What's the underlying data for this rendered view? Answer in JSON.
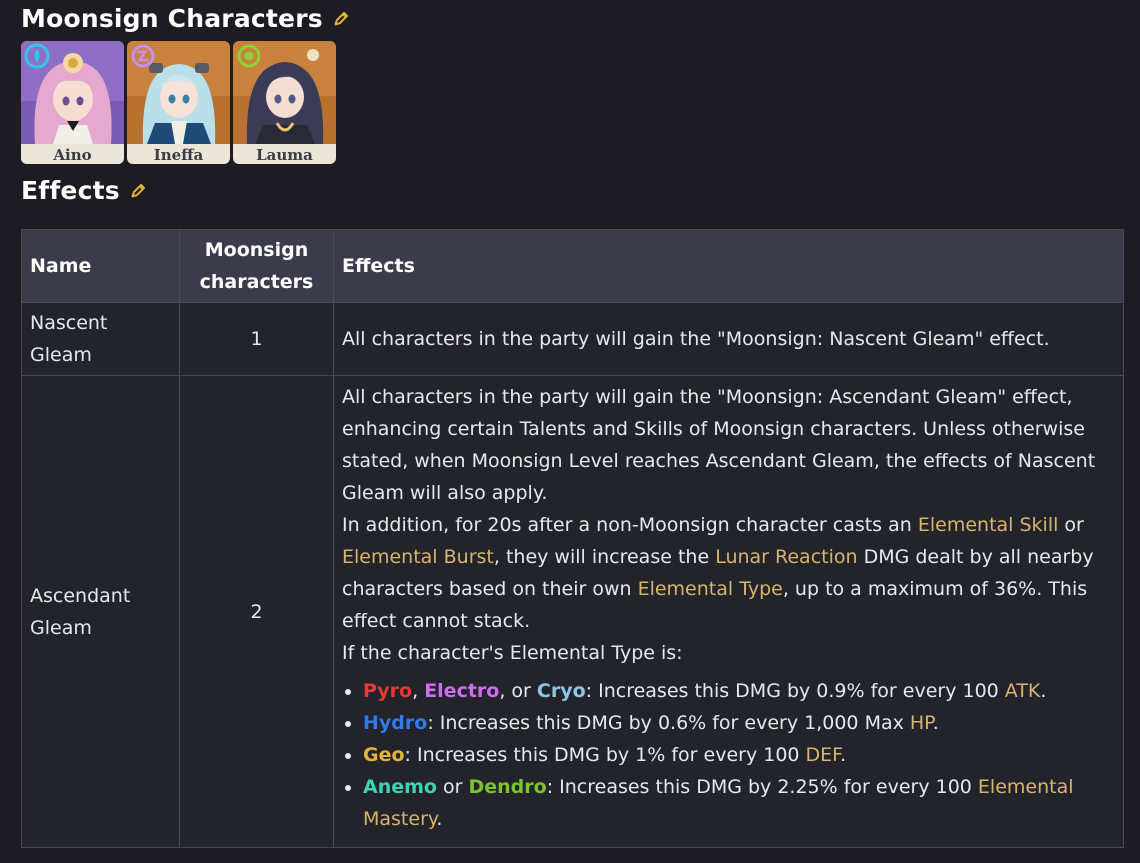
{
  "sections": {
    "characters_title": "Moonsign Characters",
    "effects_title": "Effects"
  },
  "characters": [
    {
      "name": "Aino",
      "element_icon": "hydro-icon"
    },
    {
      "name": "Ineffa",
      "element_icon": "electro-icon"
    },
    {
      "name": "Lauma",
      "element_icon": "dendro-icon"
    }
  ],
  "table": {
    "headers": {
      "name": "Name",
      "count": "Moonsign characters",
      "effects": "Effects"
    },
    "rows": [
      {
        "name": "Nascent Gleam",
        "count": "1",
        "effect": "All characters in the party will gain the \"Moonsign: Nascent Gleam\" effect."
      },
      {
        "name": "Ascendant Gleam",
        "count": "2",
        "effect_intro": "All characters in the party will gain the \"Moonsign: Ascendant Gleam\" effect, enhancing certain Talents and Skills of Moonsign characters. Unless otherwise stated, when Moonsign Level reaches Ascendant Gleam, the effects of Nascent Gleam will also apply.",
        "p2": {
          "a": "In addition, for 20s after a non-Moonsign character casts an ",
          "link1": "Elemental Skill",
          "b": " or ",
          "link2": "Elemental Burst",
          "c": ", they will increase the ",
          "link3": "Lunar Reaction",
          "d": " DMG dealt by all nearby characters based on their own ",
          "link4": "Elemental Type",
          "e": ", up to a maximum of 36%. This effect cannot stack."
        },
        "p3": "If the character's Elemental Type is:",
        "bullets": {
          "b1": {
            "pyro": "Pyro",
            "sep1": ", ",
            "electro": "Electro",
            "sep2": ", or ",
            "cryo": "Cryo",
            "text": ": Increases this DMG by 0.9% for every 100 ",
            "link": "ATK",
            "end": "."
          },
          "b2": {
            "hydro": "Hydro",
            "text": ": Increases this DMG by 0.6% for every 1,000 Max ",
            "link": "HP",
            "end": "."
          },
          "b3": {
            "geo": "Geo",
            "text": ": Increases this DMG by 1% for every 100 ",
            "link": "DEF",
            "end": "."
          },
          "b4": {
            "anemo": "Anemo",
            "sep": " or ",
            "dendro": "Dendro",
            "text": ": Increases this DMG by 2.25% for every 100 ",
            "link": "Elemental Mastery",
            "end": "."
          }
        }
      }
    ]
  },
  "colors": {
    "background": "#1c1c22",
    "header_bg": "#3b3b4b",
    "link": "#d8b46c",
    "pyro": "#e8382f",
    "electro": "#d26cf3",
    "cryo": "#8fc6e4",
    "hydro": "#2e7bf0",
    "geo": "#e2b53a",
    "anemo": "#3fd2b3",
    "dendro": "#7bc42c"
  }
}
